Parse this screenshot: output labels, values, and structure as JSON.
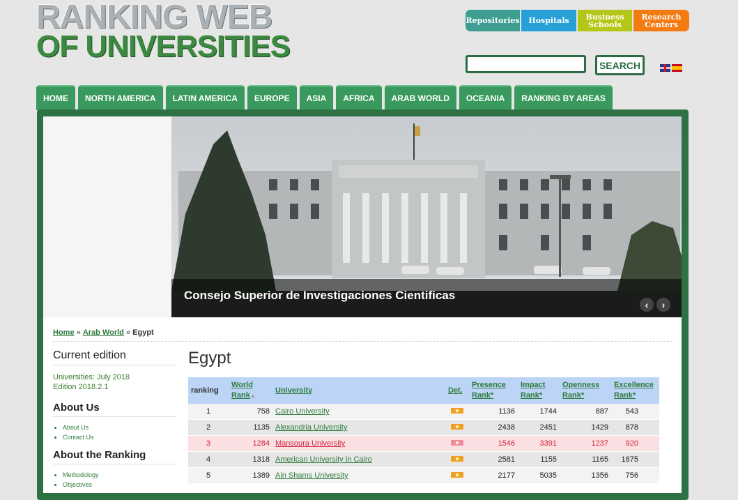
{
  "logo": {
    "line1": "RANKING WEB",
    "line2": "OF UNIVERSITIES"
  },
  "topcats": [
    {
      "label": "Repositories",
      "color": "#3e9e92"
    },
    {
      "label": "Hospitals",
      "color": "#26a0d6"
    },
    {
      "label": "Business Schools",
      "color": "#b4c616"
    },
    {
      "label": "Research Centers",
      "color": "#f47b12"
    }
  ],
  "search": {
    "button": "SEARCH",
    "placeholder": ""
  },
  "languages": [
    "english-flag",
    "spanish-flag"
  ],
  "nav": [
    "HOME",
    "NORTH AMERICA",
    "LATIN AMERICA",
    "EUROPE",
    "ASIA",
    "AFRICA",
    "ARAB WORLD",
    "OCEANIA",
    "RANKING BY AREAS"
  ],
  "slider": {
    "caption": "Consejo Superior de Investigaciones Cientificas",
    "prev": "‹",
    "next": "›"
  },
  "breadcrumb": {
    "home": "Home",
    "sep1": "»",
    "arab": "Arab World",
    "sep2": "»",
    "current": "Egypt"
  },
  "sidebar": {
    "current_title": "Current edition",
    "edition_line1": "Universities: July 2018",
    "edition_line2": "Edition 2018.2.1",
    "about_title": "About Us",
    "about_links": [
      "About Us",
      "Contact Us"
    ],
    "ranking_title": "About the Ranking",
    "ranking_links": [
      "Methodology",
      "Objectives"
    ]
  },
  "page_title": "Egypt",
  "table": {
    "headers": {
      "ranking": "ranking",
      "world_rank_1": "World",
      "world_rank_2": "Rank",
      "university": "University",
      "det": "Det.",
      "presence_1": "Presence",
      "presence_2": "Rank*",
      "impact_1": "Impact",
      "impact_2": "Rank*",
      "openness_1": "Openness",
      "openness_2": "Rank*",
      "excellence_1": "Excellence",
      "excellence_2": "Rank*"
    },
    "rows": [
      {
        "ranking": "1",
        "world": "758",
        "university": "Cairo University",
        "presence": "1136",
        "impact": "1744",
        "openness": "887",
        "excellence": "543"
      },
      {
        "ranking": "2",
        "world": "1135",
        "university": "Alexandria University",
        "presence": "2438",
        "impact": "2451",
        "openness": "1429",
        "excellence": "878"
      },
      {
        "ranking": "3",
        "world": "1284",
        "university": "Mansoura University",
        "presence": "1546",
        "impact": "3391",
        "openness": "1237",
        "excellence": "920"
      },
      {
        "ranking": "4",
        "world": "1318",
        "university": "American University in Cairo",
        "presence": "2581",
        "impact": "1155",
        "openness": "1165",
        "excellence": "1875"
      },
      {
        "ranking": "5",
        "world": "1389",
        "university": "Ain Shams University",
        "presence": "2177",
        "impact": "5035",
        "openness": "1356",
        "excellence": "756"
      }
    ],
    "highlight_row": 2
  }
}
